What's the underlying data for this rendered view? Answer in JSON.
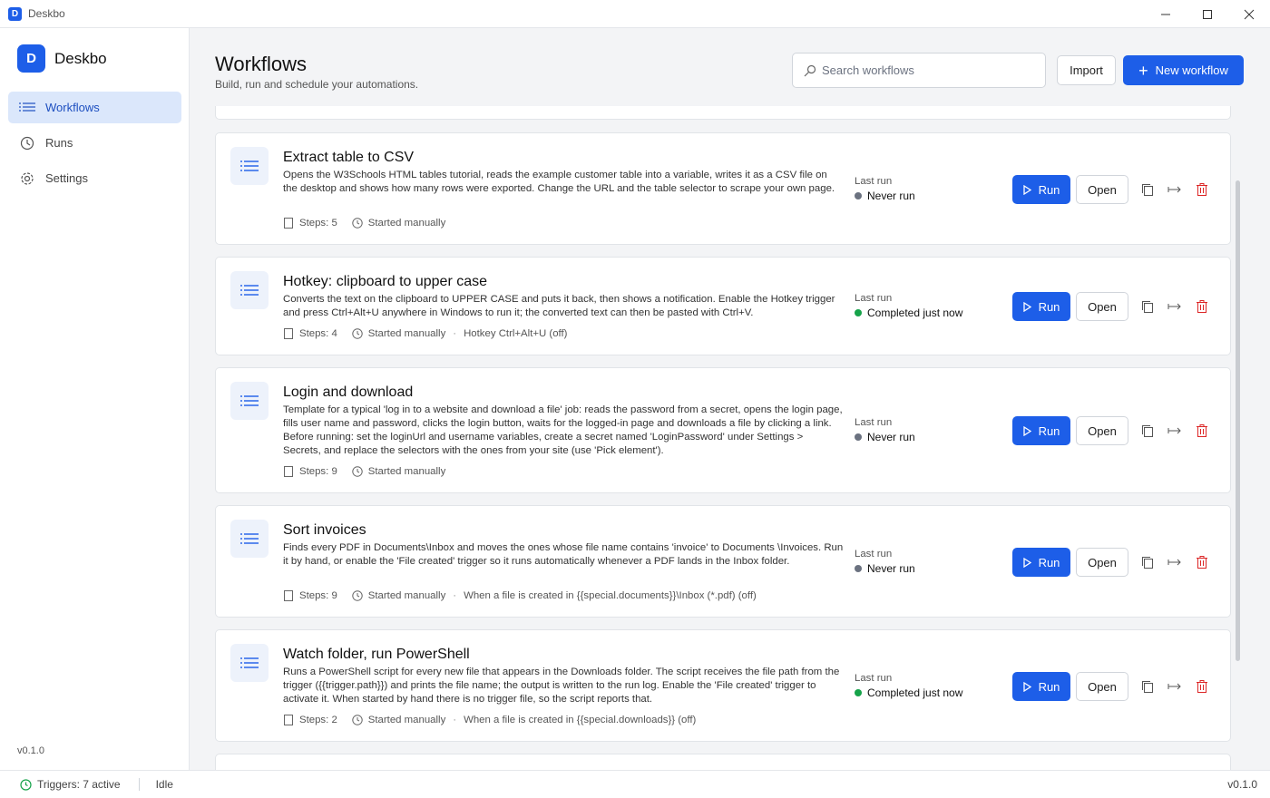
{
  "window": {
    "title": "Deskbo",
    "app_letter": "D"
  },
  "sidebar": {
    "brand": "Deskbo",
    "logo_letter": "D",
    "items": [
      {
        "label": "Workflows",
        "icon": "list-icon",
        "active": true
      },
      {
        "label": "Runs",
        "icon": "history-icon",
        "active": false
      },
      {
        "label": "Settings",
        "icon": "gear-icon",
        "active": false
      }
    ],
    "version": "v0.1.0"
  },
  "header": {
    "title": "Workflows",
    "subtitle": "Build, run and schedule your automations.",
    "search_placeholder": "Search workflows",
    "import_label": "Import",
    "new_label": "New workflow"
  },
  "workflows": [
    {
      "title": "Extract table to CSV",
      "description": "Opens the W3Schools HTML tables tutorial, reads the example customer table into a variable, writes it as a CSV file on the desktop and shows how many rows were exported. Change the URL and the table selector to scrape your own page.",
      "steps": "Steps: 5",
      "start": "Started manually",
      "trigger": "",
      "last_run_label": "Last run",
      "last_run": "Never run",
      "status_color": "#6b7280",
      "run_label": "Run",
      "open_label": "Open"
    },
    {
      "title": "Hotkey: clipboard to upper case",
      "description": "Converts the text on the clipboard to UPPER CASE and puts it back, then shows a notification. Enable the Hotkey trigger and press Ctrl+Alt+U anywhere in Windows to run it; the converted text can then be pasted with Ctrl+V.",
      "steps": "Steps: 4",
      "start": "Started manually",
      "trigger": "Hotkey Ctrl+Alt+U (off)",
      "last_run_label": "Last run",
      "last_run": "Completed just now",
      "status_color": "#16a34a",
      "run_label": "Run",
      "open_label": "Open"
    },
    {
      "title": "Login and download",
      "description": "Template for a typical 'log in to a website and download a file' job: reads the password from a secret, opens the login page, fills user name and password, clicks the login button, waits for the logged-in page and downloads a file by clicking a link. Before running: set the loginUrl and username variables, create a secret named 'LoginPassword' under Settings > Secrets, and replace the selectors with the ones from your site (use 'Pick element').",
      "steps": "Steps: 9",
      "start": "Started manually",
      "trigger": "",
      "last_run_label": "Last run",
      "last_run": "Never run",
      "status_color": "#6b7280",
      "run_label": "Run",
      "open_label": "Open"
    },
    {
      "title": "Sort invoices",
      "description": "Finds every PDF in Documents\\Inbox and moves the ones whose file name contains 'invoice' to Documents \\Invoices. Run it by hand, or enable the 'File created' trigger so it runs automatically whenever a PDF lands in the Inbox folder.",
      "steps": "Steps: 9",
      "start": "Started manually",
      "trigger": "When a file is created in {{special.documents}}\\Inbox (*.pdf) (off)",
      "last_run_label": "Last run",
      "last_run": "Never run",
      "status_color": "#6b7280",
      "run_label": "Run",
      "open_label": "Open"
    },
    {
      "title": "Watch folder, run PowerShell",
      "description": "Runs a PowerShell script for every new file that appears in the Downloads folder. The script receives the file path from the trigger ({{trigger.path}}) and prints the file name; the output is written to the run log. Enable the 'File created' trigger to activate it. When started by hand there is no trigger file, so the script reports that.",
      "steps": "Steps: 2",
      "start": "Started manually",
      "trigger": "When a file is created in {{special.downloads}} (off)",
      "last_run_label": "Last run",
      "last_run": "Completed just now",
      "status_color": "#16a34a",
      "run_label": "Run",
      "open_label": "Open"
    }
  ],
  "statusbar": {
    "triggers": "Triggers: 7 active",
    "state": "Idle",
    "version": "v0.1.0"
  }
}
